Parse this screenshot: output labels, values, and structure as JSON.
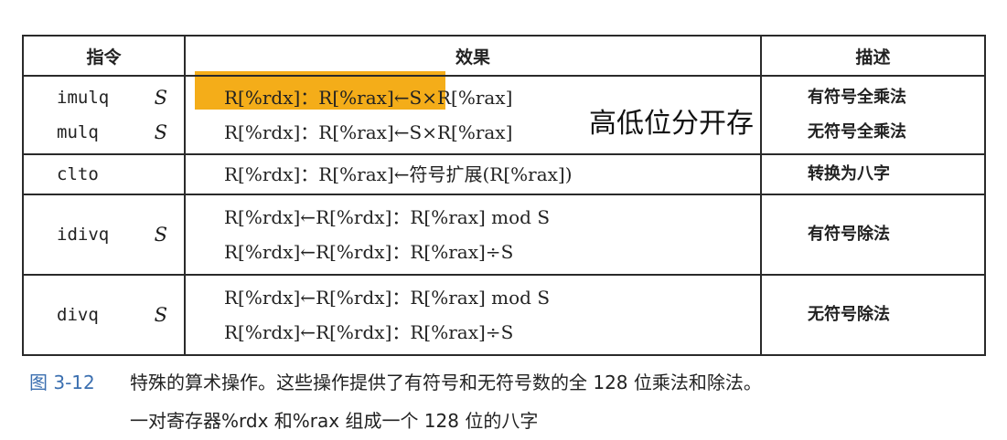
{
  "header": {
    "col_instr": "指令",
    "col_effect": "效果",
    "col_desc": "描述"
  },
  "rows": [
    {
      "lines": [
        {
          "instr": "imulq",
          "operand": "S",
          "effect": "R[%rdx]：R[%rax]←S×R[%rax]",
          "desc": "有符号全乘法"
        },
        {
          "instr": "mulq",
          "operand": "S",
          "effect": "R[%rdx]：R[%rax]←S×R[%rax]",
          "desc": "无符号全乘法"
        }
      ]
    },
    {
      "instr": "clto",
      "operand": "",
      "effect": "R[%rdx]：R[%rax]←符号扩展(R[%rax])",
      "desc": "转换为八字"
    },
    {
      "instr": "idivq",
      "operand": "S",
      "effect1": "R[%rdx]←R[%rdx]：R[%rax] mod S",
      "effect2": "R[%rdx]←R[%rdx]：R[%rax]÷S",
      "desc": "有符号除法"
    },
    {
      "instr": "divq",
      "operand": "S",
      "effect1": "R[%rdx]←R[%rdx]：R[%rax] mod S",
      "effect2": "R[%rdx]←R[%rdx]：R[%rax]÷S",
      "desc": "无符号除法"
    }
  ],
  "annotation": "高低位分开存",
  "highlight_color": "#f4ad19",
  "caption": {
    "label": "图 3-12",
    "line1": "特殊的算术操作。这些操作提供了有符号和无符号数的全 128 位乘法和除法。",
    "line2": "一对寄存器%rdx 和%rax 组成一个 128 位的八字"
  }
}
